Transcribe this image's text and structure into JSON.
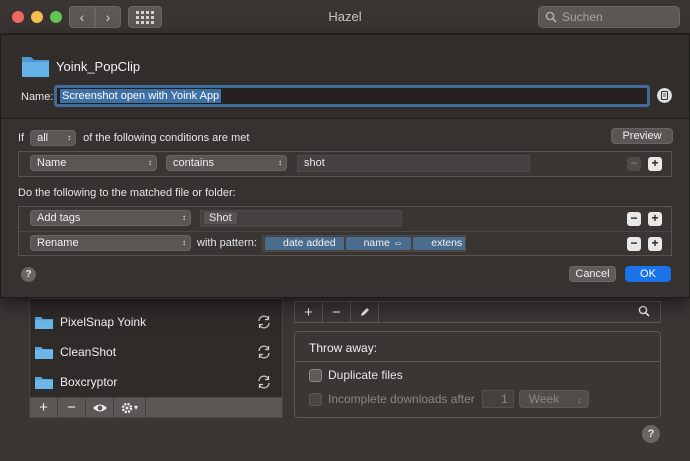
{
  "window": {
    "title": "Hazel"
  },
  "toolbar": {
    "search_placeholder": "Suchen"
  },
  "sheet": {
    "folder_name": "Yoink_PopClip",
    "name_label": "Name:",
    "name_value": "Screenshot open with Yoink App",
    "conditions": {
      "prefix": "If",
      "match_value": "all",
      "suffix": "of the following conditions are met",
      "preview_label": "Preview",
      "rules": [
        {
          "attribute": "Name",
          "operator": "contains",
          "value": "shot"
        }
      ]
    },
    "actions": {
      "label": "Do the following to the matched file or folder:",
      "rules": [
        {
          "action": "Add tags",
          "value": "Shot"
        },
        {
          "action": "Rename",
          "pattern_label": "with pattern:",
          "tokens": [
            "date added",
            "name ⇔",
            "extens"
          ]
        }
      ]
    },
    "help_label": "?",
    "cancel_label": "Cancel",
    "ok_label": "OK"
  },
  "folders": [
    {
      "name": "PixelSnap Yoink"
    },
    {
      "name": "CleanShot"
    },
    {
      "name": "Boxcryptor"
    }
  ],
  "left_toolbar": {
    "add": "+",
    "remove": "−"
  },
  "right_toolbar": {
    "add": "+",
    "remove": "−"
  },
  "trash": {
    "title": "Throw away:",
    "duplicate_label": "Duplicate files",
    "incomplete_label": "Incomplete downloads after",
    "incomplete_count": "1",
    "period": "Week"
  },
  "help_label": "?",
  "colors": {
    "accent": "#1a73e8",
    "selection": "#3e6fa5",
    "folder": "#5aa5dc"
  }
}
